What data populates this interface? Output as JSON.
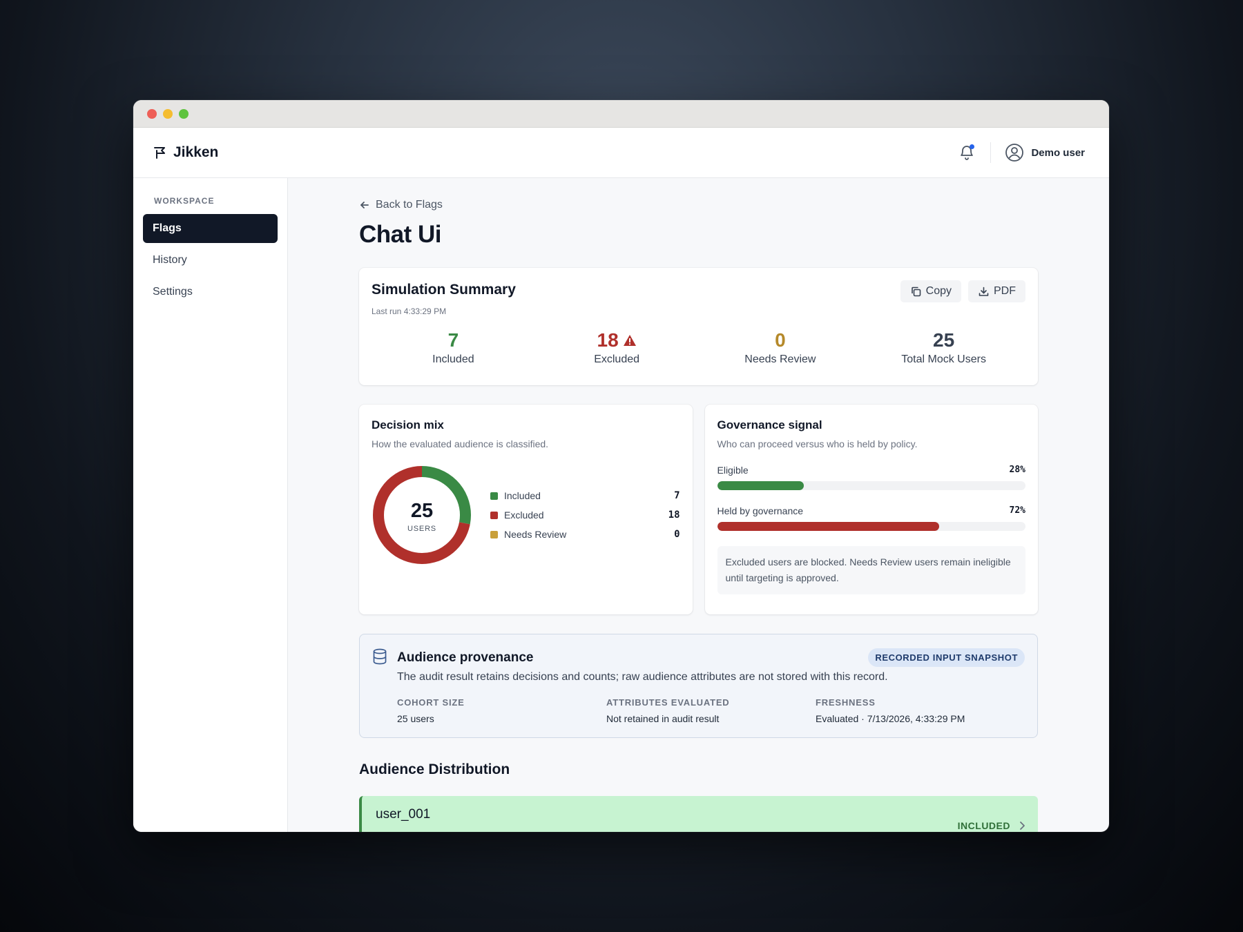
{
  "app": {
    "name": "Jikken",
    "user_name": "Demo user"
  },
  "sidebar": {
    "heading": "WORKSPACE",
    "items": [
      {
        "label": "Flags",
        "active": true
      },
      {
        "label": "History",
        "active": false
      },
      {
        "label": "Settings",
        "active": false
      }
    ]
  },
  "page": {
    "back_label": "Back to Flags",
    "title": "Chat Ui"
  },
  "summary": {
    "title": "Simulation Summary",
    "last_run": "Last run 4:33:29 PM",
    "copy_label": "Copy",
    "pdf_label": "PDF",
    "stats": [
      {
        "value": "7",
        "label": "Included",
        "color": "#3a8a45"
      },
      {
        "value": "18",
        "label": "Excluded",
        "color": "#b0302b",
        "warning": true
      },
      {
        "value": "0",
        "label": "Needs Review",
        "color": "#b5892a"
      },
      {
        "value": "25",
        "label": "Total Mock Users",
        "color": "#374151"
      }
    ]
  },
  "decision_mix": {
    "title": "Decision mix",
    "description": "How the evaluated audience is classified.",
    "center_value": "25",
    "center_label": "USERS",
    "items": [
      {
        "label": "Included",
        "value": 7,
        "color": "#3a8a45"
      },
      {
        "label": "Excluded",
        "value": 18,
        "color": "#b0302b"
      },
      {
        "label": "Needs Review",
        "value": 0,
        "color": "#c9a03a"
      }
    ]
  },
  "governance": {
    "title": "Governance signal",
    "description": "Who can proceed versus who is held by policy.",
    "bars": [
      {
        "label": "Eligible",
        "percent_label": "28%",
        "fraction": 0.28,
        "color": "#3a8a45"
      },
      {
        "label": "Held by governance",
        "percent_label": "72%",
        "fraction": 0.72,
        "color": "#b0302b"
      }
    ],
    "note": "Excluded users are blocked. Needs Review users remain ineligible until targeting is approved."
  },
  "provenance": {
    "title": "Audience provenance",
    "badge": "RECORDED INPUT SNAPSHOT",
    "description": "The audit result retains decisions and counts; raw audience attributes are not stored with this record.",
    "columns": [
      {
        "key": "COHORT SIZE",
        "value": "25 users"
      },
      {
        "key": "ATTRIBUTES EVALUATED",
        "value": "Not retained in audit result"
      },
      {
        "key": "FRESHNESS",
        "value": "Evaluated · 7/13/2026, 4:33:29 PM"
      }
    ]
  },
  "distribution": {
    "title": "Audience Distribution",
    "rows": [
      {
        "user_id": "user_001",
        "status": "INCLUDED"
      }
    ]
  },
  "icons": [
    "flag-logo-icon",
    "bell-icon",
    "user-circle-icon",
    "arrow-left-icon",
    "copy-icon",
    "download-icon",
    "warning-icon",
    "database-icon",
    "chevron-right-icon"
  ]
}
